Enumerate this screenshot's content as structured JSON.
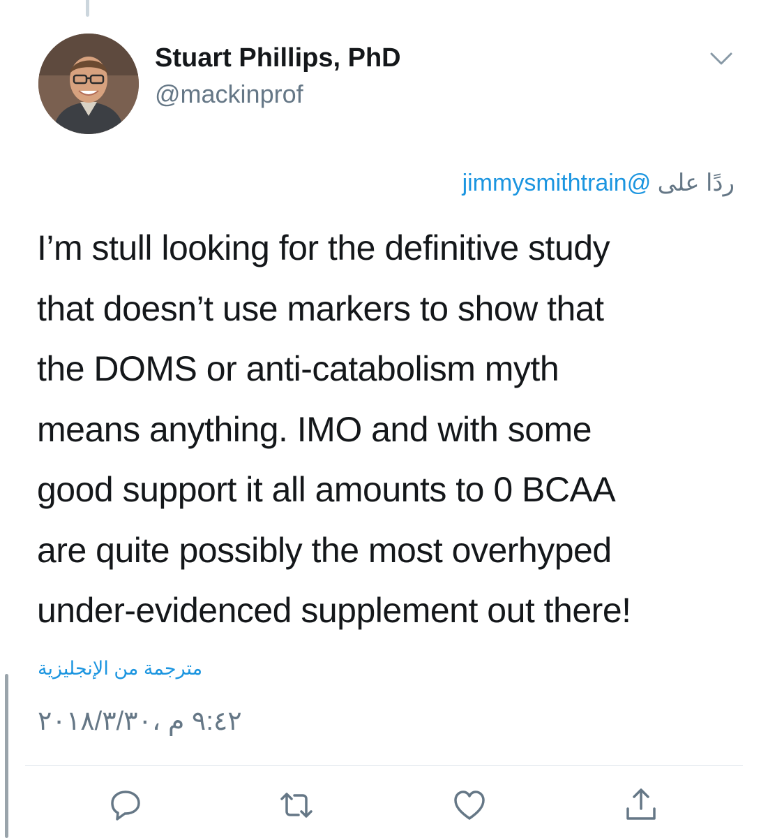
{
  "author": {
    "display_name": "Stuart Phillips, PhD",
    "handle": "@mackinprof"
  },
  "reply": {
    "prefix": "ردًا على",
    "mention": "@jimmysmithtrain"
  },
  "tweet": {
    "lines": [
      "I’m stull looking for the definitive study",
      "that doesn’t use markers to show that",
      "the DOMS or anti-catabolism myth",
      "means anything. IMO and with some",
      "good support it all amounts to 0 BCAA",
      "are quite possibly the most overhyped",
      "under-evidenced supplement out there!"
    ]
  },
  "translation_label": "مترجمة من الإنجليزية",
  "timestamp": "٩:٤٢ م ،٢٠١٨/٣/٣٠",
  "icons": {
    "caret": "chevron-down-icon",
    "reply": "reply-icon",
    "retweet": "retweet-icon",
    "like": "heart-icon",
    "share": "share-icon"
  },
  "colors": {
    "link": "#1b95e0",
    "secondary": "#657786",
    "text": "#14171a",
    "divider": "#e1e8ed"
  }
}
